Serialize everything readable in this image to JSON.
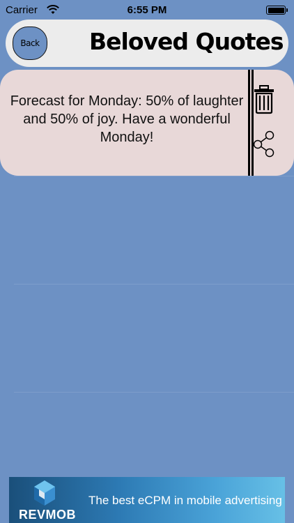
{
  "status_bar": {
    "carrier": "Carrier",
    "time": "6:55 PM"
  },
  "header": {
    "back_label": "Back",
    "title": "Beloved Quotes"
  },
  "quotes": [
    {
      "text": "Forecast for Monday: 50% of laughter and 50% of joy. Have a wonderful Monday!",
      "actions": [
        "trash-icon",
        "share-icon"
      ]
    }
  ],
  "ad": {
    "brand": "REVMOB",
    "slogan": "The best eCPM in mobile advertising"
  },
  "colors": {
    "background": "#6d91c4",
    "header": "#ececec",
    "card": "#e8d8d8"
  }
}
